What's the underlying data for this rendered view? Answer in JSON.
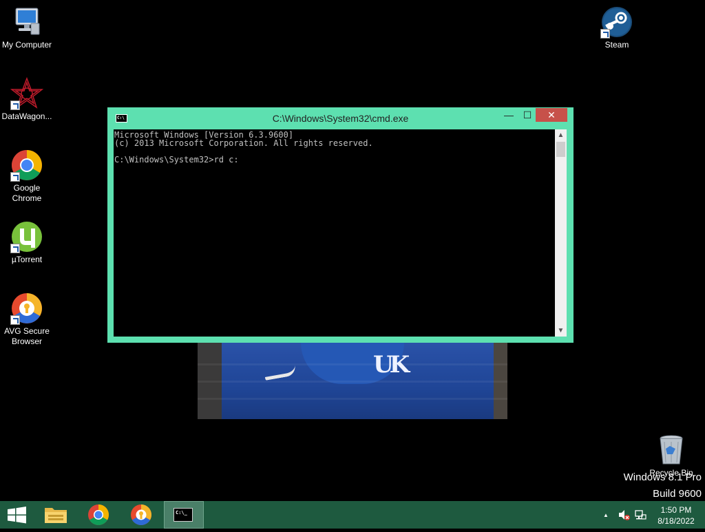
{
  "desktop": {
    "icons": [
      {
        "label": "My Computer"
      },
      {
        "label": "DataWagon..."
      },
      {
        "label": "Google Chrome"
      },
      {
        "label": "µTorrent"
      },
      {
        "label": "AVG Secure Browser"
      },
      {
        "label": "Steam"
      },
      {
        "label": "Recycle Bin"
      }
    ]
  },
  "cmd": {
    "title": "C:\\Windows\\System32\\cmd.exe",
    "icon_text": "C:\\",
    "lines": [
      "Microsoft Windows [Version 6.3.9600]",
      "(c) 2013 Microsoft Corporation. All rights reserved.",
      "",
      "C:\\Windows\\System32>rd c:"
    ],
    "minimize": "—",
    "maximize": "☐",
    "close": "✕"
  },
  "watermark": {
    "line1": "Windows 8.1 Pro",
    "line2": "Build 9600"
  },
  "taskbar": {
    "clock_time": "1:50 PM",
    "clock_date": "8/18/2022",
    "tray_expand": "▲",
    "cmd_icon_text": "C:\\_"
  },
  "colors": {
    "window_frame": "#5de0b0",
    "taskbar": "#1e5a3f",
    "close_button": "#c7514a"
  }
}
